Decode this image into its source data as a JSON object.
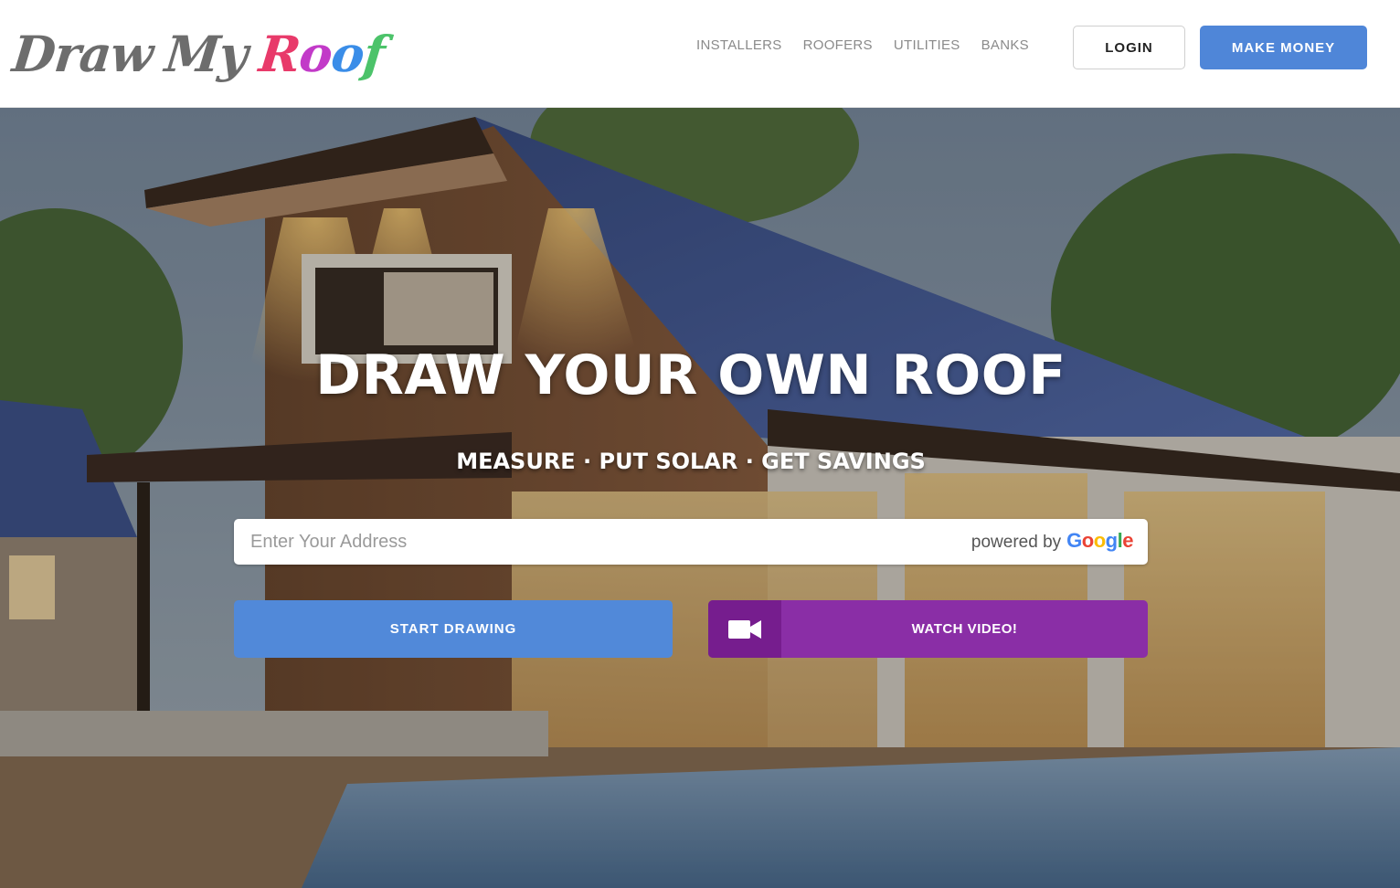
{
  "logo": {
    "word1": "Draw",
    "word2": "My",
    "word3_letters": [
      "R",
      "o",
      "o",
      "f"
    ],
    "word3_colors": [
      "#e83a6a",
      "#c23ac8",
      "#3a8de8",
      "#4cc36a"
    ],
    "alt": "Draw My Roof"
  },
  "nav": {
    "items": [
      "INSTALLERS",
      "ROOFERS",
      "UTILITIES",
      "BANKS"
    ]
  },
  "header": {
    "login_label": "LOGIN",
    "cta_label": "MAKE MONEY"
  },
  "hero": {
    "title": "DRAW YOUR OWN ROOF",
    "subtitle": "MEASURE · PUT SOLAR · GET SAVINGS",
    "address": {
      "placeholder": "Enter Your Address",
      "value": ""
    },
    "powered_by": "powered by",
    "google_letters": [
      "G",
      "o",
      "o",
      "g",
      "l",
      "e"
    ],
    "google_colors": [
      "#4285F4",
      "#EA4335",
      "#FBBC05",
      "#4285F4",
      "#34A853",
      "#EA4335"
    ],
    "start_label": "START DRAWING",
    "video_label": "WATCH VIDEO!",
    "video_icon": "video-camera-icon"
  },
  "colors": {
    "accent_blue": "#4f86d8",
    "video_purple": "#8a2ea6"
  }
}
